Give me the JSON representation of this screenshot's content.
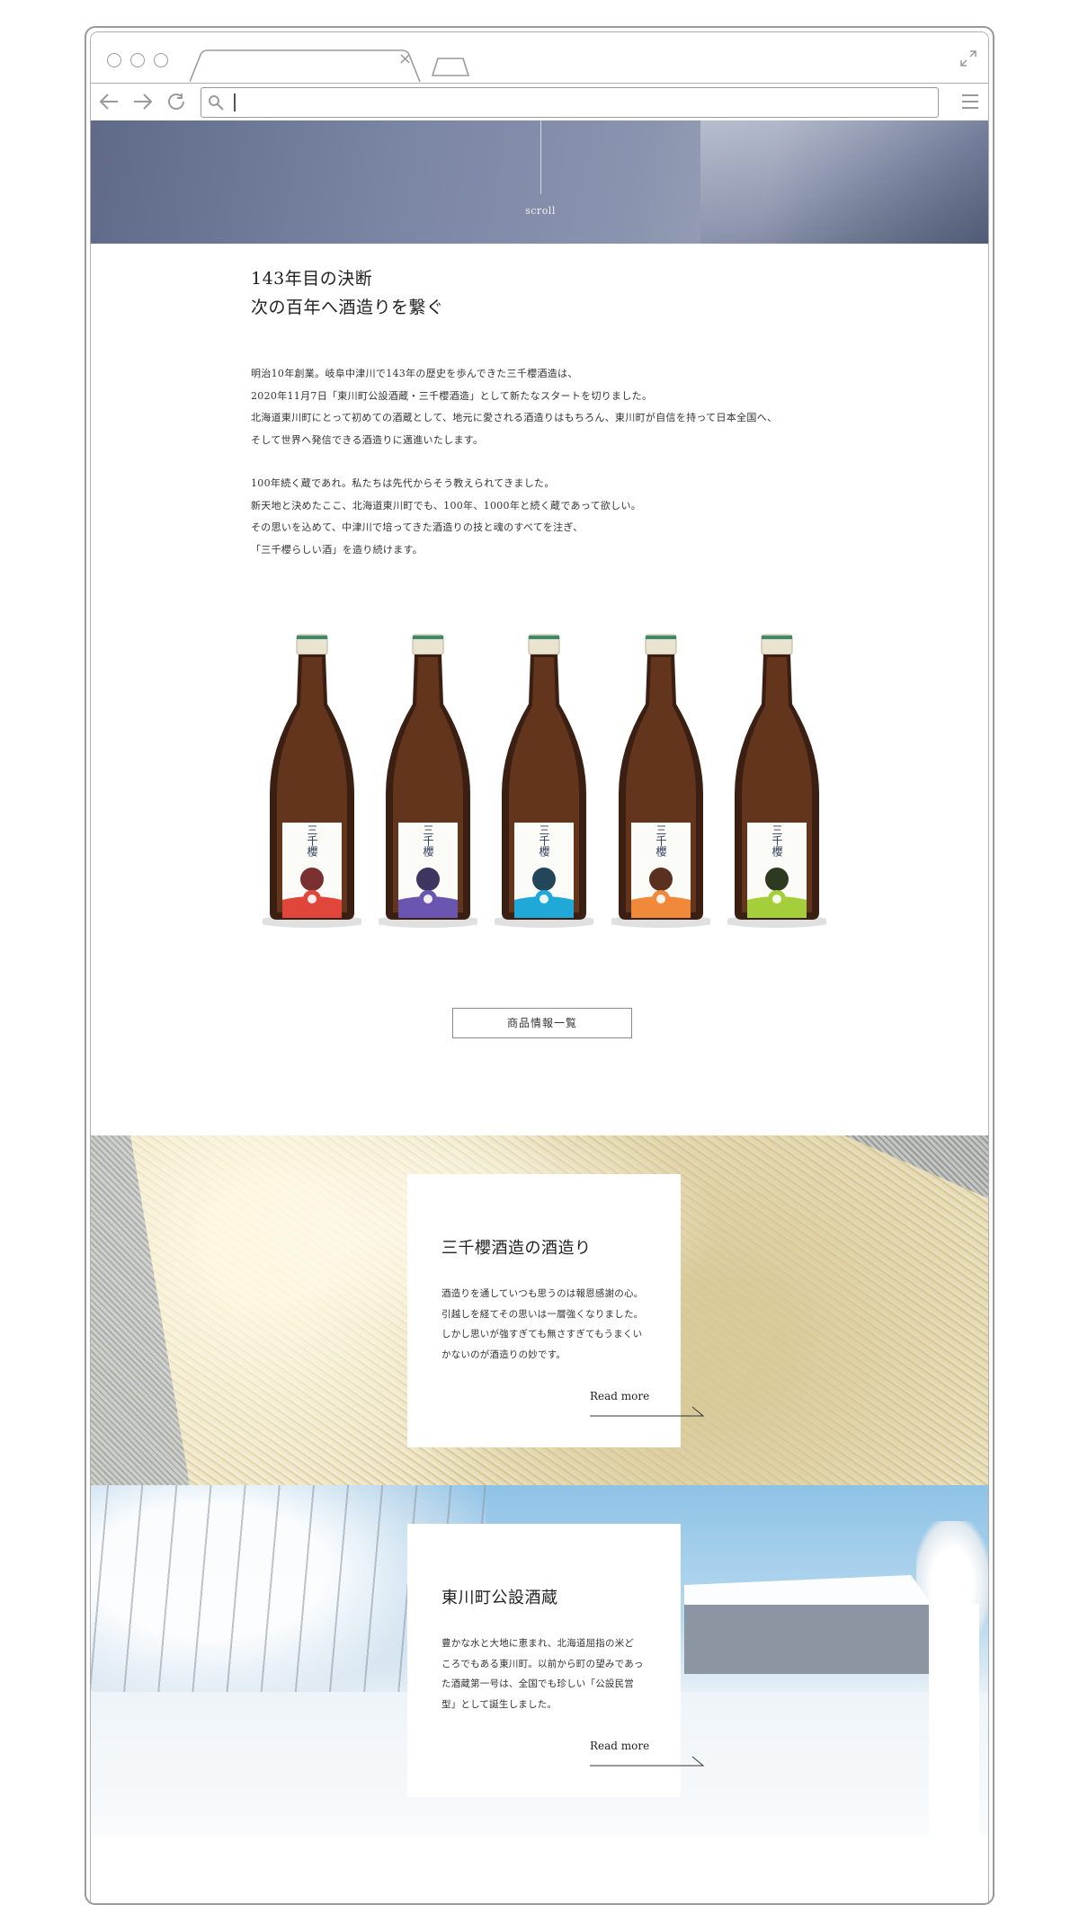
{
  "browser": {
    "url_value": "",
    "icons": [
      "back-arrow-icon",
      "forward-arrow-icon",
      "reload-icon",
      "search-icon",
      "menu-icon",
      "expand-icon",
      "close-icon",
      "new-tab-icon"
    ]
  },
  "hero": {
    "scroll_label": "scroll"
  },
  "intro": {
    "heading_line1": "143年目の決断",
    "heading_line2": "次の百年へ酒造りを繋ぐ",
    "para1": [
      "明治10年創業。岐阜中津川で143年の歴史を歩んできた三千櫻酒造は、",
      "2020年11月7日「東川町公設酒蔵・三千櫻酒造」として新たなスタートを切りました。",
      "北海道東川町にとって初めての酒蔵として、地元に愛される酒造りはもちろん、東川町が自信を持って日本全国へ、",
      "そして世界へ発信できる酒造りに邁進いたします。"
    ],
    "para2": [
      "100年続く蔵であれ。私たちは先代からそう教えられてきました。",
      "新天地と決めたここ、北海道東川町でも、100年、1000年と続く蔵であって欲しい。",
      "その思いを込めて、中津川で培ってきた酒造りの技と魂のすべてを注ぎ、",
      "「三千櫻らしい酒」を造り続けます。"
    ]
  },
  "bottles": [
    {
      "brand": "三千櫻",
      "color": "#e0463a",
      "badge": "#7a3030"
    },
    {
      "brand": "三千櫻",
      "color": "#6a55b0",
      "badge": "#3e3560"
    },
    {
      "brand": "三千櫻",
      "color": "#1fa8d8",
      "badge": "#24465a"
    },
    {
      "brand": "三千櫻",
      "color": "#f08a3a",
      "badge": "#5a3020"
    },
    {
      "brand": "三千櫻",
      "color": "#a4cf3a",
      "badge": "#2e3a20"
    }
  ],
  "product_button": "商品情報一覧",
  "section1": {
    "title": "三千櫻酒造の酒造り",
    "lines": [
      "酒造りを通していつも思うのは報恩感謝の心。",
      "引越しを経てその思いは一層強くなりました。",
      "しかし思いが強すぎても無さすぎてもうまくい",
      "かないのが酒造りの妙です。"
    ],
    "more": "Read more"
  },
  "section2": {
    "title": "東川町公設酒蔵",
    "lines": [
      "豊かな水と大地に恵まれ、北海道屈指の米ど",
      "ころでもある東川町。以前から町の望みであっ",
      "た酒蔵第一号は、全国でも珍しい「公設民営",
      "型」として誕生しました。"
    ],
    "more": "Read more"
  }
}
